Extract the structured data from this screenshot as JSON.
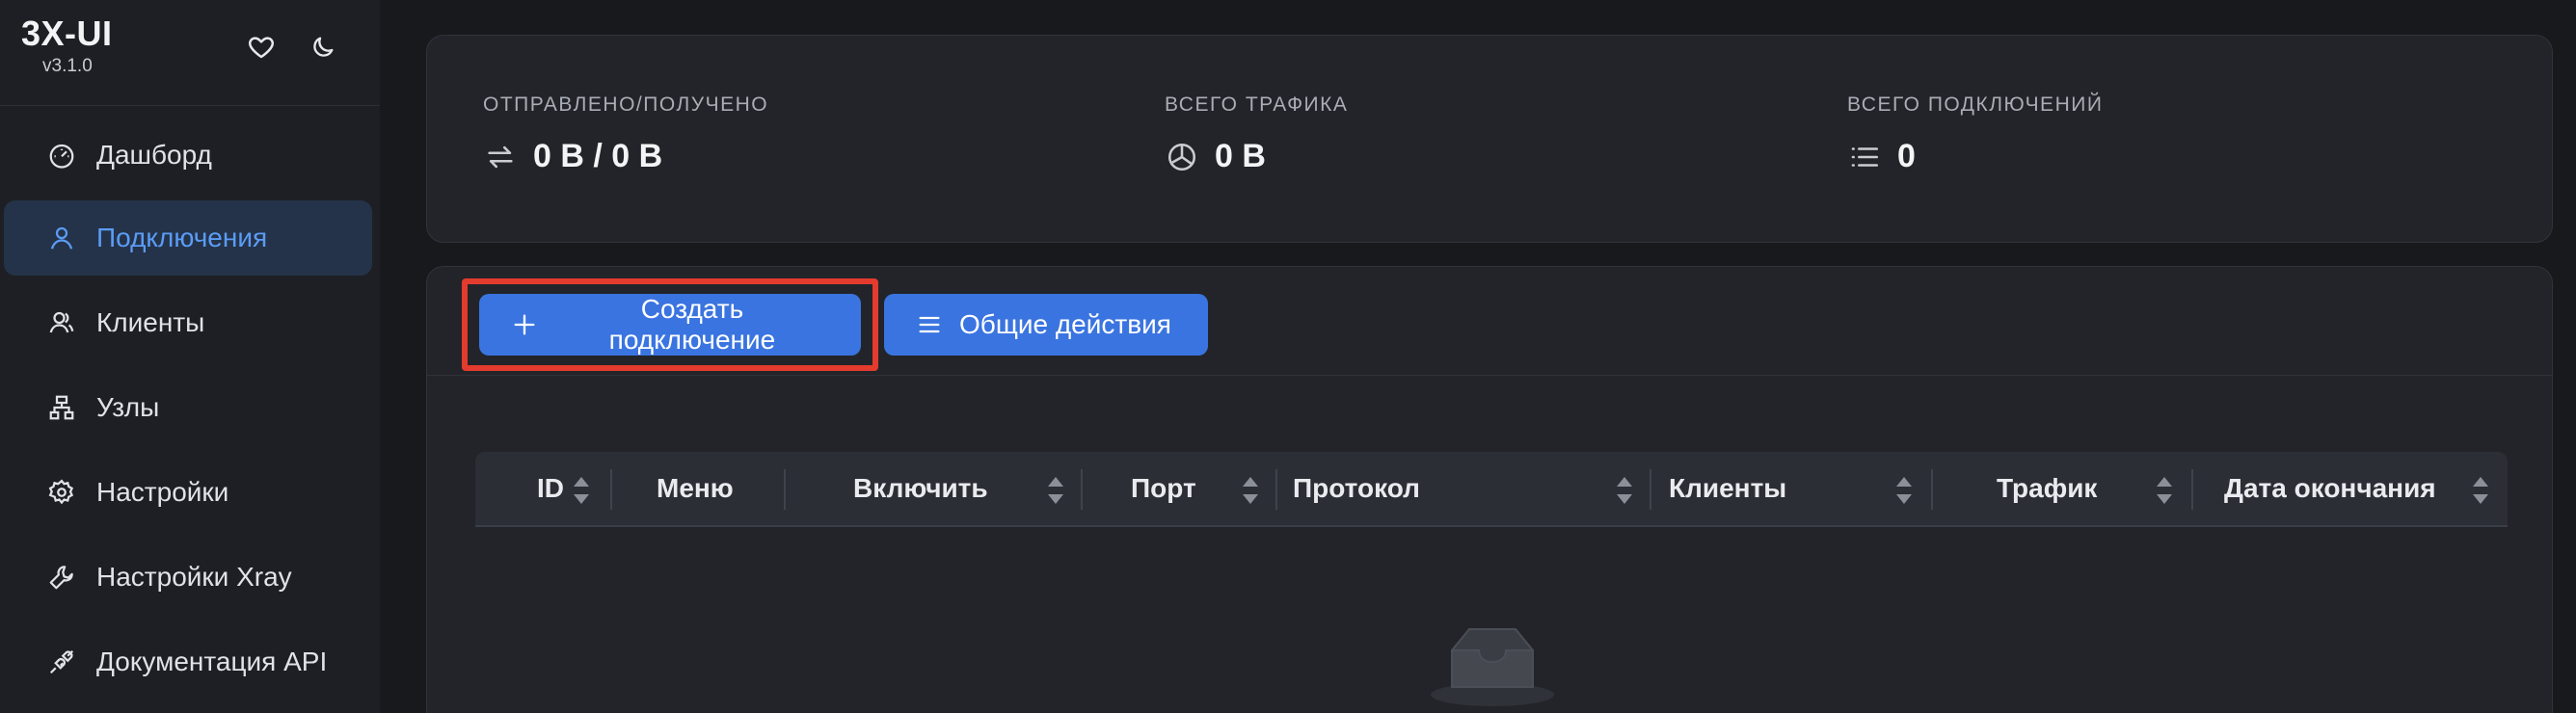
{
  "brand": {
    "title": "3X-UI",
    "version": "v3.1.0"
  },
  "header_icons": [
    "heart-icon",
    "moon-icon"
  ],
  "sidebar": {
    "items": [
      {
        "label": "Дашборд",
        "icon": "dashboard-icon",
        "active": false
      },
      {
        "label": "Подключения",
        "icon": "user-icon",
        "active": true
      },
      {
        "label": "Клиенты",
        "icon": "users-icon",
        "active": false
      },
      {
        "label": "Узлы",
        "icon": "cluster-icon",
        "active": false
      },
      {
        "label": "Настройки",
        "icon": "gear-icon",
        "active": false
      },
      {
        "label": "Настройки Xray",
        "icon": "wrench-icon",
        "active": false
      },
      {
        "label": "Документация API",
        "icon": "api-icon",
        "active": false
      }
    ]
  },
  "stats": [
    {
      "label": "ОТПРАВЛЕНО/ПОЛУЧЕНО",
      "value": "0 B / 0 B",
      "icon": "swap-icon"
    },
    {
      "label": "ВСЕГО ТРАФИКА",
      "value": "0 B",
      "icon": "pie-chart-icon"
    },
    {
      "label": "ВСЕГО ПОДКЛЮЧЕНИЙ",
      "value": "0",
      "icon": "list-icon"
    }
  ],
  "toolbar": {
    "create_label": "Создать подключение",
    "general_actions_label": "Общие действия"
  },
  "table": {
    "columns": [
      "ID",
      "Меню",
      "Включить",
      "Порт",
      "Протокол",
      "Клиенты",
      "Трафик",
      "Дата окончания"
    ],
    "rows": []
  },
  "colors": {
    "accent": "#3a74e0",
    "active_nav_bg": "#243349",
    "active_nav_text": "#5b9cf5",
    "highlight_outline": "#e33b2e"
  }
}
